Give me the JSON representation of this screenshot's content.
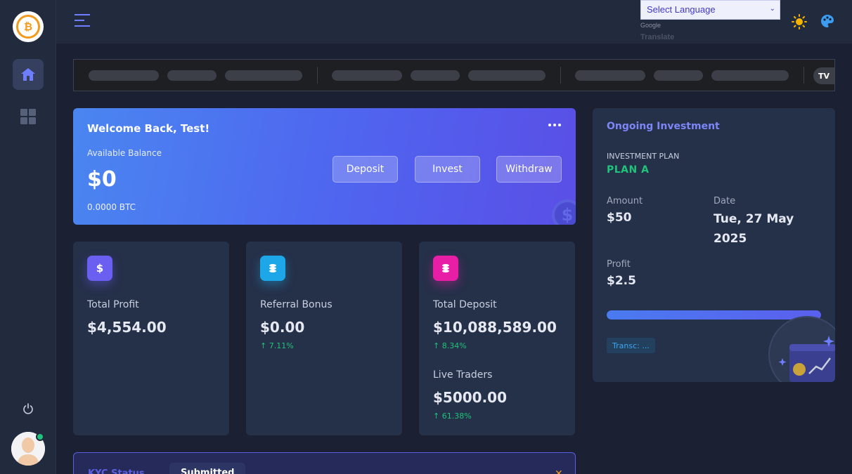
{
  "topbar": {
    "language_select": "Select Language",
    "google_text": "Google",
    "translate_text": "Translate"
  },
  "ticker": {
    "logo_text": "TV"
  },
  "welcome": {
    "title": "Welcome Back, Test!",
    "balance_label": "Available Balance",
    "balance_value": "$0",
    "btc_value": "0.0000 BTC",
    "buttons": {
      "deposit": "Deposit",
      "invest": "Invest",
      "withdraw": "Withdraw"
    }
  },
  "stats": [
    {
      "icon": "dollar-icon",
      "label": "Total Profit",
      "value": "$4,554.00"
    },
    {
      "icon": "coins-icon",
      "label": "Referral Bonus",
      "value": "$0.00",
      "change": "↑ 7.11%"
    },
    {
      "icon": "coins-icon",
      "label": "Total Deposit",
      "value": "$10,088,589.00",
      "change": "↑ 8.34%",
      "label2": "Live Traders",
      "value2": "$5000.00",
      "change2": "↑ 61.38%"
    }
  ],
  "investment": {
    "title": "Ongoing Investment",
    "plan_label": "INVESTMENT PLAN",
    "plan_name": "PLAN A",
    "amount_label": "Amount",
    "amount_value": "$50",
    "date_label": "Date",
    "date_value": "Tue, 27 May 2025",
    "profit_label": "Profit",
    "profit_value": "$2.5",
    "progress": 1.0,
    "transaction_badge": "Transc: ..."
  },
  "kyc": {
    "status_label": "KYC Status",
    "status_value": "Submitted"
  },
  "colors": {
    "accent": "#5a5fe0",
    "success": "#20c37a",
    "warning": "#f29a1e",
    "card": "#253049",
    "bg": "#1b2133"
  }
}
